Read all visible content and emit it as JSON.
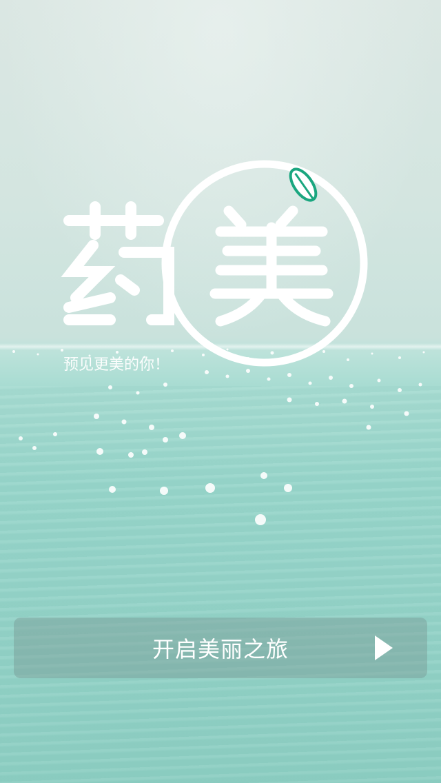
{
  "logo": {
    "char_left": "药",
    "char_right": "美",
    "leaf_color": "#1aa67f",
    "icon": "leaf-icon"
  },
  "tagline": "预见更美的你！",
  "start_button": {
    "label": "开启美丽之旅",
    "icon": "play-icon"
  },
  "colors": {
    "sky": "#d3e5e0",
    "sea": "#99d6cb",
    "button_bg": "rgba(120,150,145,0.42)",
    "text": "#ffffff"
  }
}
